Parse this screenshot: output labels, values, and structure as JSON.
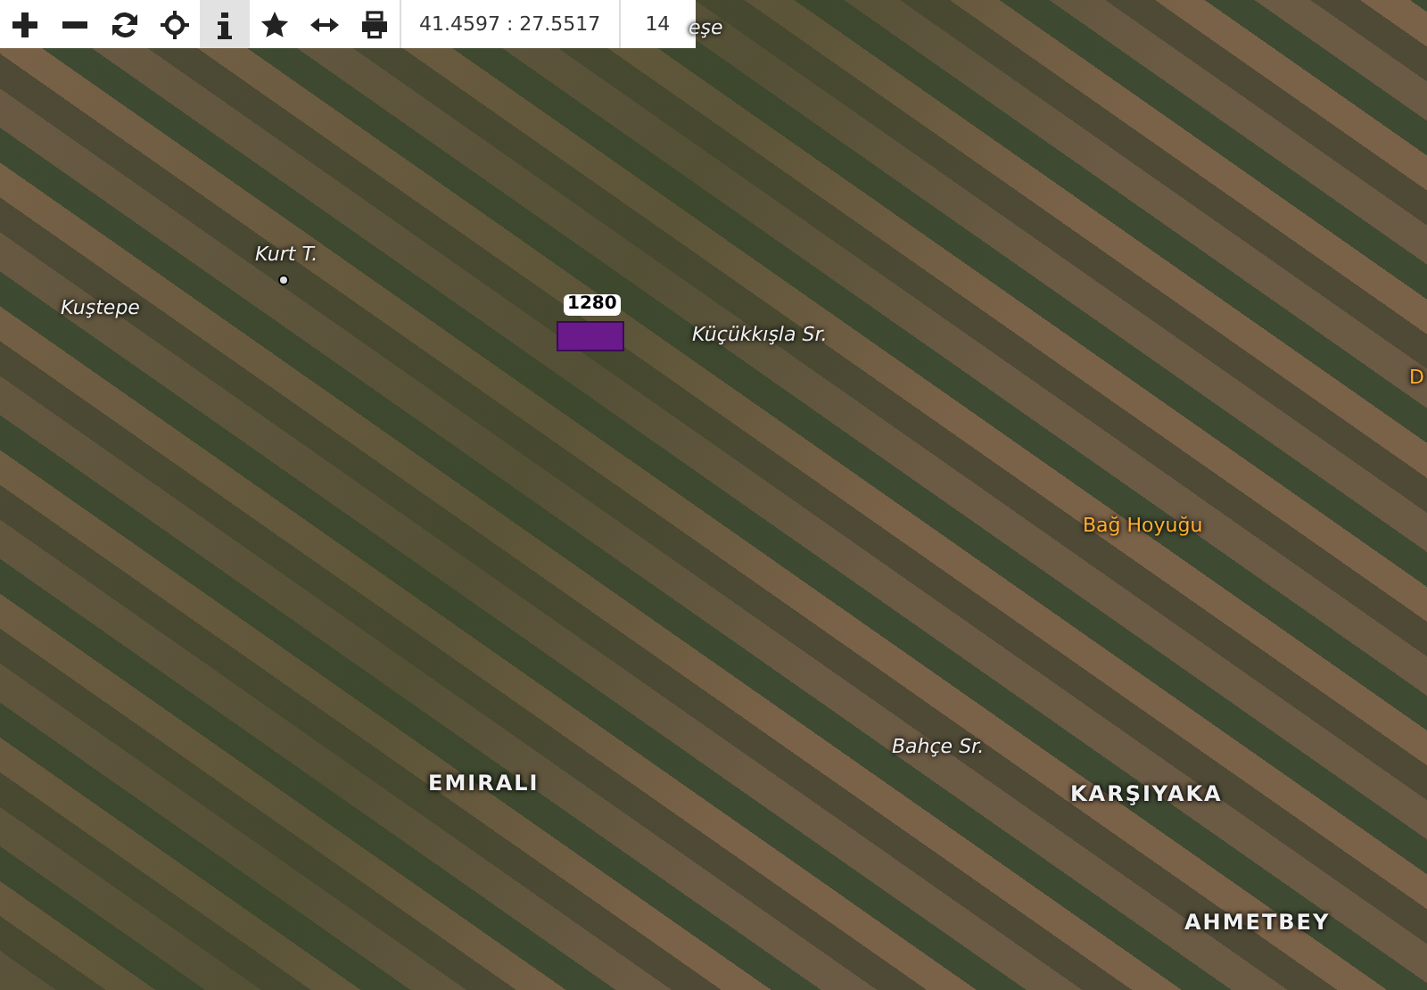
{
  "toolbar": {
    "buttons": [
      {
        "kind": "plus",
        "selected": false
      },
      {
        "kind": "minus",
        "selected": false
      },
      {
        "kind": "refresh",
        "selected": false
      },
      {
        "kind": "locate",
        "selected": false
      },
      {
        "kind": "info",
        "selected": true
      },
      {
        "kind": "star",
        "selected": false
      },
      {
        "kind": "measure",
        "selected": false
      },
      {
        "kind": "print",
        "selected": false
      }
    ],
    "coordinates": "41.4597 : 27.5517",
    "zoom": "14"
  },
  "map": {
    "parcel": {
      "label": "1280"
    },
    "labels": [
      {
        "text": "eşe",
        "kind": "area"
      },
      {
        "text": "Kurt T.",
        "kind": "point"
      },
      {
        "text": "Kuştepe",
        "kind": "area"
      },
      {
        "text": "Küçükkışla Sr.",
        "kind": "area"
      },
      {
        "text": "D",
        "kind": "poi"
      },
      {
        "text": "Bağ Hoyuğu",
        "kind": "poi"
      },
      {
        "text": "Bahçe Sr.",
        "kind": "area"
      },
      {
        "text": "EMIRALI",
        "kind": "town"
      },
      {
        "text": "KARŞIYAKA",
        "kind": "town"
      },
      {
        "text": "AHMETBEY",
        "kind": "town"
      }
    ]
  }
}
